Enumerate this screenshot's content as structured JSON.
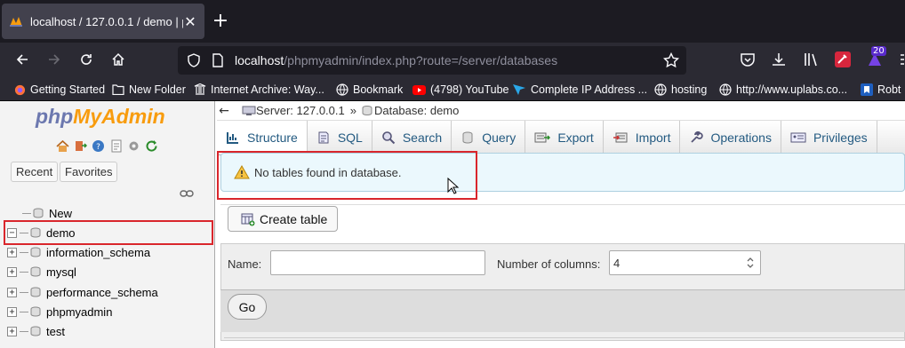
{
  "browser": {
    "tab_title": "localhost / 127.0.0.1 / demo | ph",
    "url_host": "localhost",
    "url_path": "/phpmyadmin/index.php?route=/server/databases",
    "extension_badge": "20",
    "bookmarks": [
      {
        "label": "Getting Started",
        "icon": "firefox-icon"
      },
      {
        "label": "New Folder",
        "icon": "folder-icon"
      },
      {
        "label": "Internet Archive: Way...",
        "icon": "archive-icon"
      },
      {
        "label": "Bookmark",
        "icon": "globe-icon"
      },
      {
        "label": "(4798) YouTube",
        "icon": "youtube-icon"
      },
      {
        "label": "Complete IP Address ...",
        "icon": "ip-icon"
      },
      {
        "label": "hosting",
        "icon": "globe-icon"
      },
      {
        "label": "http://www.uplabs.co...",
        "icon": "globe-icon"
      },
      {
        "label": "Robt",
        "icon": "bookmark-icon"
      }
    ]
  },
  "sidebar": {
    "logo_php": "php",
    "logo_rest": "MyAdmin",
    "recent_label": "Recent",
    "favorites_label": "Favorites",
    "items": [
      {
        "label": "New"
      },
      {
        "label": "demo"
      },
      {
        "label": "information_schema"
      },
      {
        "label": "mysql"
      },
      {
        "label": "performance_schema"
      },
      {
        "label": "phpmyadmin"
      },
      {
        "label": "test"
      }
    ]
  },
  "breadcrumb": {
    "server": "Server: 127.0.0.1",
    "separator": "»",
    "database": "Database: demo"
  },
  "tabs": [
    {
      "label": "Structure"
    },
    {
      "label": "SQL"
    },
    {
      "label": "Search"
    },
    {
      "label": "Query"
    },
    {
      "label": "Export"
    },
    {
      "label": "Import"
    },
    {
      "label": "Operations"
    },
    {
      "label": "Privileges"
    }
  ],
  "notice": {
    "text": "No tables found in database."
  },
  "create_table": {
    "button_label": "Create table",
    "name_label": "Name:",
    "name_value": "",
    "columns_label": "Number of columns:",
    "columns_value": "4",
    "go_label": "Go"
  },
  "colors": {
    "accent": "#235a81",
    "highlight": "#d9262c",
    "logo_php": "#6c78af",
    "logo_admin": "#f89c0e"
  }
}
